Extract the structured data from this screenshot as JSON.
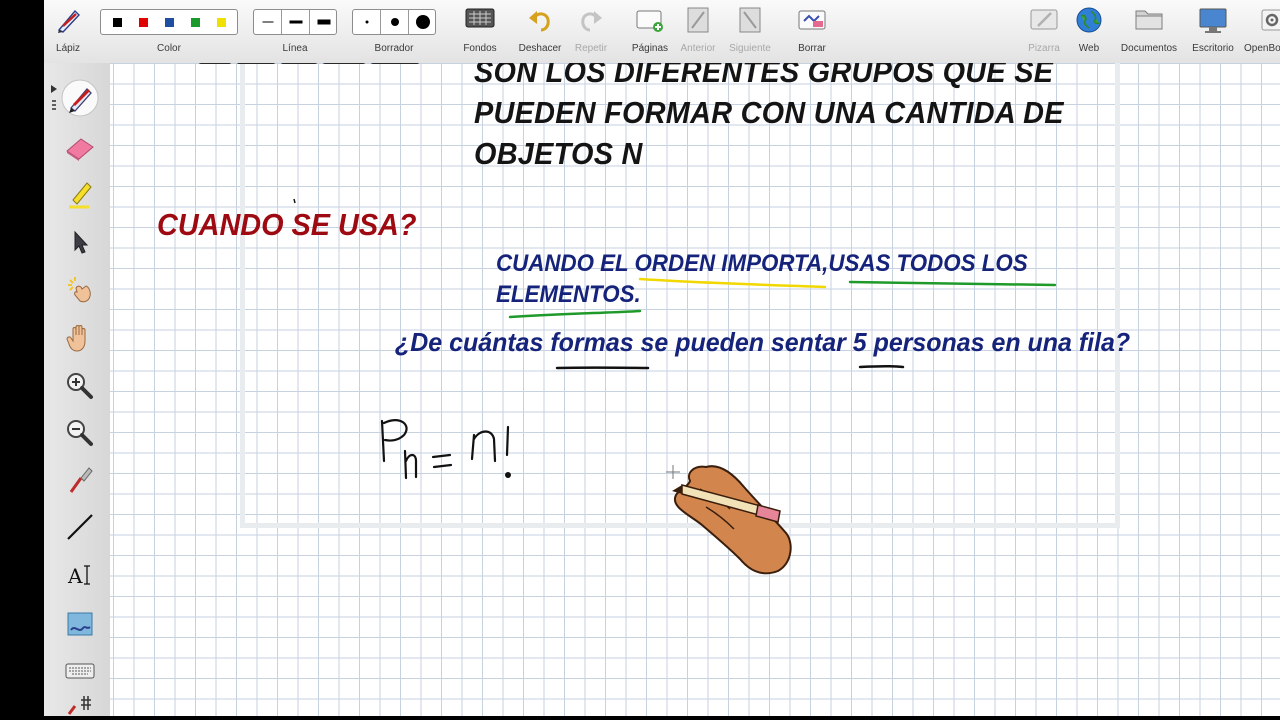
{
  "toolbar": {
    "pencil_label": "Lápiz",
    "color_label": "Color",
    "line_label": "Línea",
    "eraser_label": "Borrador",
    "backgrounds_label": "Fondos",
    "undo_label": "Deshacer",
    "redo_label": "Repetir",
    "pages_label": "Páginas",
    "previous_label": "Anterior",
    "next_label": "Siguiente",
    "clear_label": "Borrar",
    "whiteboard_label": "Pizarra",
    "web_label": "Web",
    "documents_label": "Documentos",
    "desktop_label": "Escritorio",
    "openboard_label": "OpenBoard"
  },
  "colors": [
    "#000000",
    "#e00000",
    "#1f4fa0",
    "#1a9a2a",
    "#f0e000"
  ],
  "left_tools": [
    "pen-icon",
    "eraser-icon",
    "highlighter-icon",
    "pointer-icon",
    "laser-pointer-icon",
    "hand-icon",
    "zoom-in-icon",
    "zoom-out-icon",
    "capture-icon",
    "line-icon",
    "text-icon",
    "screenshot-icon",
    "keyboard-icon",
    "more-icon"
  ],
  "board": {
    "definition_lines": [
      "SON LOS DIFERENTES GRUPOS QUE SE",
      "PUEDEN FORMAR CON UNA CANTIDA DE",
      "OBJETOS N"
    ],
    "when_title": "CUANDO SE USA?",
    "rule_lines": [
      "CUANDO EL ORDEN IMPORTA,USAS TODOS LOS",
      "ELEMENTOS."
    ],
    "question": "¿De cuántas formas se pueden sentar 5 personas en una fila?"
  },
  "accent_colors": {
    "title_red": "#9e0a12",
    "text_blue": "#15237a",
    "underline_yellow": "#f0d800",
    "underline_green": "#1f9a2a"
  }
}
